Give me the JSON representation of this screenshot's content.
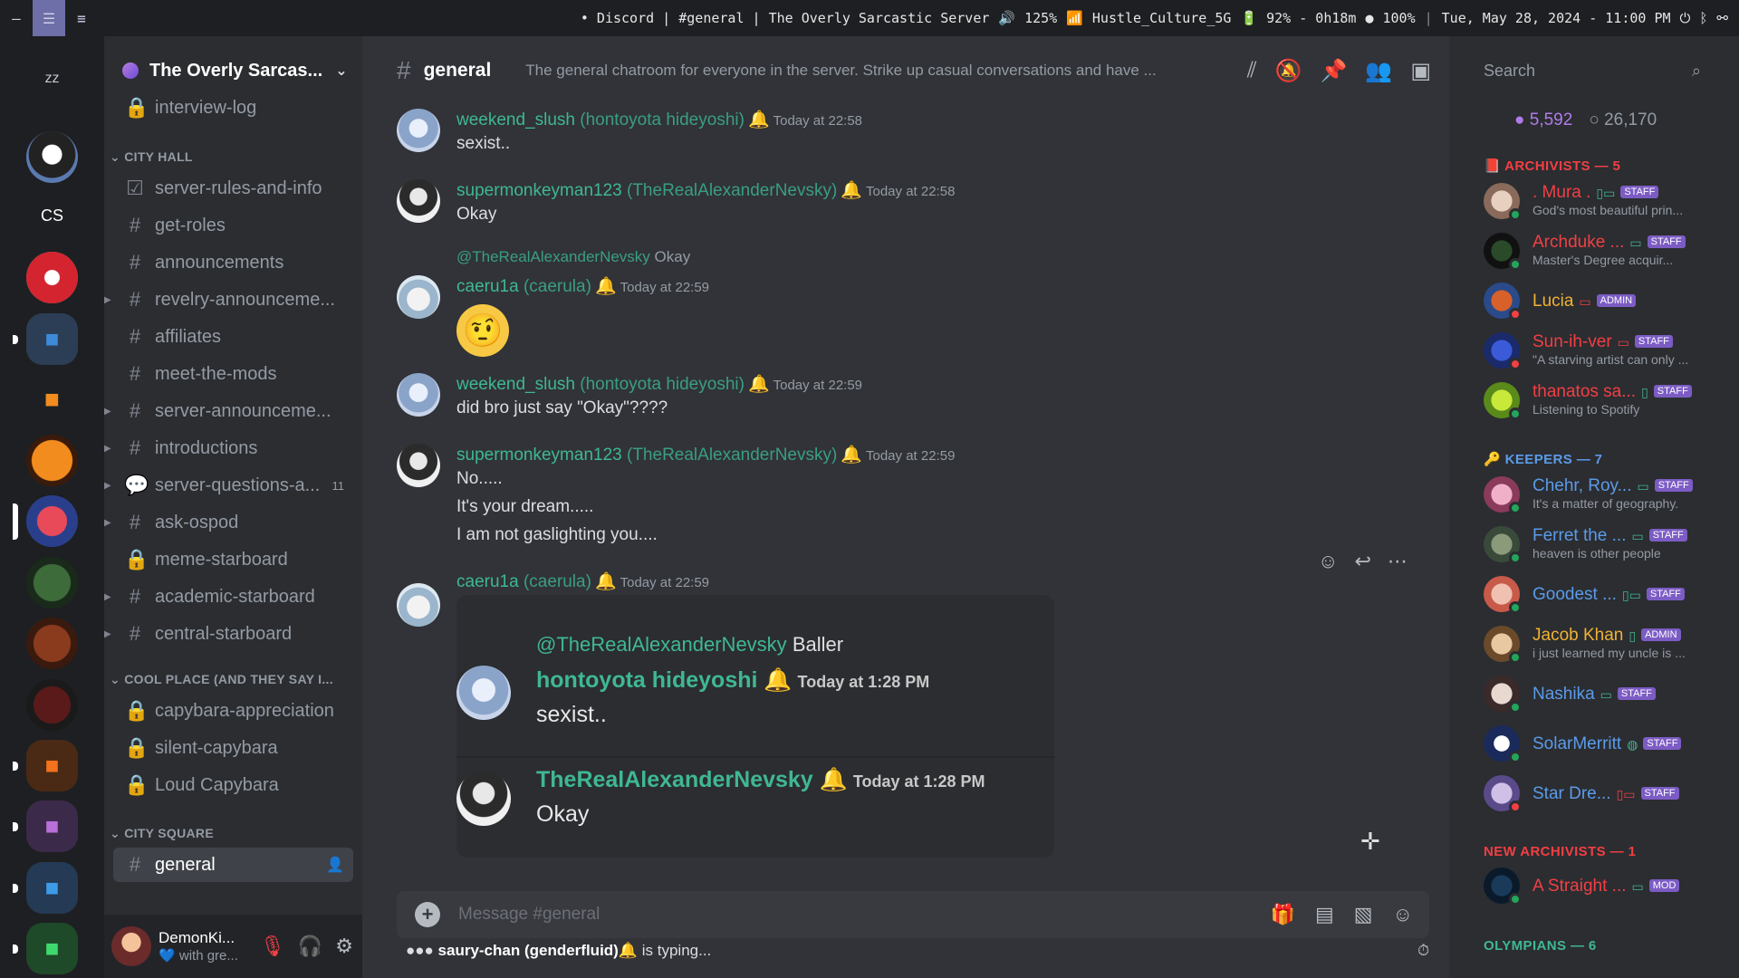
{
  "topbar": {
    "title": "• Discord | #general | The Overly Sarcastic Server",
    "volume": "125%",
    "wifi": "Hustle_Culture_5G",
    "battery": "92% - 0h18m",
    "brightness": "100%",
    "datetime": "Tue, May 28, 2024 - 11:00 PM"
  },
  "servers": {
    "cs_label": "CS"
  },
  "sidebar": {
    "server_name": "The Overly Sarcas...",
    "channels_top": [
      {
        "name": "interview-log",
        "icon": "lock-icon"
      }
    ],
    "cat1": "CITY HALL",
    "cityhall": [
      {
        "name": "server-rules-and-info"
      },
      {
        "name": "get-roles"
      },
      {
        "name": "announcements"
      },
      {
        "name": "revelry-announceme..."
      },
      {
        "name": "affiliates"
      },
      {
        "name": "meet-the-mods"
      },
      {
        "name": "server-announceme..."
      },
      {
        "name": "introductions"
      },
      {
        "name": "server-questions-a...",
        "badge": "11"
      },
      {
        "name": "ask-ospod"
      },
      {
        "name": "meme-starboard"
      },
      {
        "name": "academic-starboard"
      },
      {
        "name": "central-starboard"
      }
    ],
    "cat2": "COOL PLACE (AND THEY SAY I...",
    "coolplace": [
      {
        "name": "capybara-appreciation"
      },
      {
        "name": "silent-capybara"
      },
      {
        "name": "Loud Capybara"
      }
    ],
    "cat3": "CITY SQUARE",
    "citysquare": [
      {
        "name": "general"
      }
    ],
    "user": {
      "name": "DemonKi...",
      "status": "with gre..."
    }
  },
  "header": {
    "channel": "general",
    "topic": "The general chatroom for everyone in the server. Strike up casual conversations and have ..."
  },
  "messages": [
    {
      "name": "weekend_slush",
      "handle": "(hontoyota hideyoshi)",
      "time": "Today at 22:58",
      "lines": [
        "sexist.."
      ]
    },
    {
      "name": "supermonkeyman123",
      "handle": "(TheRealAlexanderNevsky)",
      "time": "Today at 22:58",
      "lines": [
        "Okay"
      ]
    },
    {
      "reply_to": "@TheRealAlexanderNevsky",
      "reply_text": "Okay",
      "name": "caeru1a",
      "handle": "(caerula)",
      "time": "Today at 22:59",
      "emoji": "🤨"
    },
    {
      "name": "weekend_slush",
      "handle": "(hontoyota hideyoshi)",
      "time": "Today at 22:59",
      "lines": [
        "did bro just say \"Okay\"????"
      ]
    },
    {
      "name": "supermonkeyman123",
      "handle": "(TheRealAlexanderNevsky)",
      "time": "Today at 22:59",
      "lines": [
        "No.....",
        "It's your dream.....",
        "I am not gaslighting you...."
      ]
    },
    {
      "name": "caeru1a",
      "handle": "(caerula)",
      "time": "Today at 22:59"
    }
  ],
  "embed": {
    "reply_to": "@TheRealAlexanderNevsky",
    "reply_text": "Baller",
    "m1_name": "hontoyota hideyoshi",
    "m1_time": "Today at 1:28 PM",
    "m1_text": "sexist..",
    "m2_name": "TheRealAlexanderNevsky",
    "m2_time": "Today at 1:28 PM",
    "m2_text": "Okay"
  },
  "composer": {
    "placeholder": "Message #general"
  },
  "typing": {
    "who": "saury-chan (genderfluid)",
    "suffix": "is typing..."
  },
  "members": {
    "search_placeholder": "Search",
    "online": "5,592",
    "total": "26,170",
    "groups": [
      {
        "title": "ARCHIVISTS — 5",
        "color": "#f23f43"
      },
      {
        "title": "KEEPERS — 7",
        "color": "#5b9be8"
      },
      {
        "title": "NEW ARCHIVISTS — 1",
        "color": "#f23f43"
      },
      {
        "title": "OLYMPIANS — 6",
        "color": "#3fb891"
      }
    ],
    "list": [
      {
        "name": ". Mura .",
        "tag": "STAFF",
        "status": "God's most beautiful prin...",
        "color": "#f23f43"
      },
      {
        "name": "Archduke ...",
        "tag": "STAFF",
        "status": "Master's Degree acquir...",
        "color": "#f23f43"
      },
      {
        "name": "Lucia",
        "tag": "ADMIN",
        "status": "",
        "color": "#f0b232"
      },
      {
        "name": "Sun-ih-ver",
        "tag": "STAFF",
        "status": "\"A starving artist can only ...",
        "color": "#f23f43"
      },
      {
        "name": "thanatos sa...",
        "tag": "STAFF",
        "status": "Listening to Spotify",
        "color": "#f23f43"
      },
      {
        "name": "Chehr, Roy...",
        "tag": "STAFF",
        "status": "It's a matter of geography.",
        "color": "#5b9be8"
      },
      {
        "name": "Ferret the ...",
        "tag": "STAFF",
        "status": "heaven is other people",
        "color": "#5b9be8"
      },
      {
        "name": "Goodest ...",
        "tag": "STAFF",
        "status": "",
        "color": "#5b9be8"
      },
      {
        "name": "Jacob Khan",
        "tag": "ADMIN",
        "status": "i just learned my uncle is ...",
        "color": "#f0b232"
      },
      {
        "name": "Nashika",
        "tag": "STAFF",
        "status": "",
        "color": "#5b9be8"
      },
      {
        "name": "SolarMerritt",
        "tag": "STAFF",
        "status": "",
        "color": "#5b9be8"
      },
      {
        "name": "Star Dre...",
        "tag": "STAFF",
        "status": "",
        "color": "#5b9be8"
      },
      {
        "name": "A Straight ...",
        "tag": "MOD",
        "status": "",
        "color": "#f23f43"
      }
    ]
  },
  "colors": {
    "bg": "#313338",
    "sidebar": "#2b2d31",
    "servers": "#1e1f22",
    "accent": "#3fb891"
  }
}
